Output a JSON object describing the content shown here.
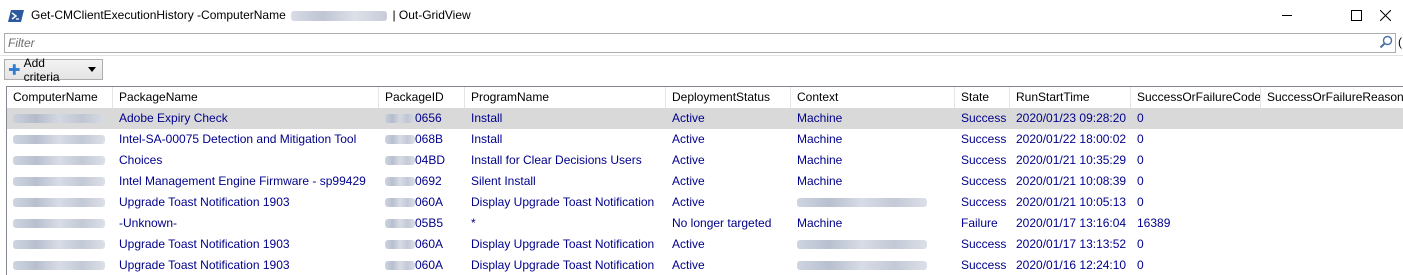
{
  "window": {
    "title_prefix": "Get-CMClientExecutionHistory -ComputerName",
    "title_suffix": "| Out-GridView",
    "controls": [
      "minimize-icon",
      "maximize-icon",
      "close-icon"
    ]
  },
  "filter": {
    "placeholder": "Filter",
    "value": ""
  },
  "toolbar": {
    "add_criteria_label": "Add criteria"
  },
  "table": {
    "columns": [
      "ComputerName",
      "PackageName",
      "PackageID",
      "ProgramName",
      "DeploymentStatus",
      "Context",
      "State",
      "RunStartTime",
      "SuccessOrFailureCode",
      "SuccessOrFailureReason"
    ],
    "rows": [
      {
        "ComputerName": "",
        "PackageName": "Adobe Expiry Check",
        "PackageID": "0656",
        "ProgramName": "Install",
        "DeploymentStatus": "Active",
        "Context": "Machine",
        "State": "Success",
        "RunStartTime": "2020/01/23 09:28:20",
        "SuccessOrFailureCode": "0",
        "SuccessOrFailureReason": ""
      },
      {
        "ComputerName": "",
        "PackageName": "Intel-SA-00075 Detection and Mitigation Tool",
        "PackageID": "068B",
        "ProgramName": "Install",
        "DeploymentStatus": "Active",
        "Context": "Machine",
        "State": "Success",
        "RunStartTime": "2020/01/22 18:00:02",
        "SuccessOrFailureCode": "0",
        "SuccessOrFailureReason": ""
      },
      {
        "ComputerName": "",
        "PackageName": "Choices",
        "PackageID": "04BD",
        "ProgramName": "Install for Clear Decisions Users",
        "DeploymentStatus": "Active",
        "Context": "Machine",
        "State": "Success",
        "RunStartTime": "2020/01/21 10:35:29",
        "SuccessOrFailureCode": "0",
        "SuccessOrFailureReason": ""
      },
      {
        "ComputerName": "",
        "PackageName": "Intel Management Engine Firmware - sp99429",
        "PackageID": "0692",
        "ProgramName": "Silent Install",
        "DeploymentStatus": "Active",
        "Context": "Machine",
        "State": "Success",
        "RunStartTime": "2020/01/21 10:08:39",
        "SuccessOrFailureCode": "0",
        "SuccessOrFailureReason": ""
      },
      {
        "ComputerName": "",
        "PackageName": "Upgrade Toast Notification 1903",
        "PackageID": "060A",
        "ProgramName": "Display Upgrade Toast Notification",
        "DeploymentStatus": "Active",
        "Context": "",
        "State": "Success",
        "RunStartTime": "2020/01/21 10:05:13",
        "SuccessOrFailureCode": "0",
        "SuccessOrFailureReason": ""
      },
      {
        "ComputerName": "",
        "PackageName": "-Unknown-",
        "PackageID": "05B5",
        "ProgramName": "*",
        "DeploymentStatus": "No longer targeted",
        "Context": "Machine",
        "State": "Failure",
        "RunStartTime": "2020/01/17 13:16:04",
        "SuccessOrFailureCode": "16389",
        "SuccessOrFailureReason": ""
      },
      {
        "ComputerName": "",
        "PackageName": "Upgrade Toast Notification 1903",
        "PackageID": "060A",
        "ProgramName": "Display Upgrade Toast Notification",
        "DeploymentStatus": "Active",
        "Context": "",
        "State": "Success",
        "RunStartTime": "2020/01/17 13:13:52",
        "SuccessOrFailureCode": "0",
        "SuccessOrFailureReason": ""
      },
      {
        "ComputerName": "",
        "PackageName": "Upgrade Toast Notification 1903",
        "PackageID": "060A",
        "ProgramName": "Display Upgrade Toast Notification",
        "DeploymentStatus": "Active",
        "Context": "",
        "State": "Success",
        "RunStartTime": "2020/01/16 12:24:10",
        "SuccessOrFailureCode": "0",
        "SuccessOrFailureReason": ""
      }
    ],
    "selected_row": 0
  },
  "colors": {
    "cell_text": "#00008b",
    "selected_row": "#d9d9d9",
    "ps_icon": "#2c5aa0"
  }
}
